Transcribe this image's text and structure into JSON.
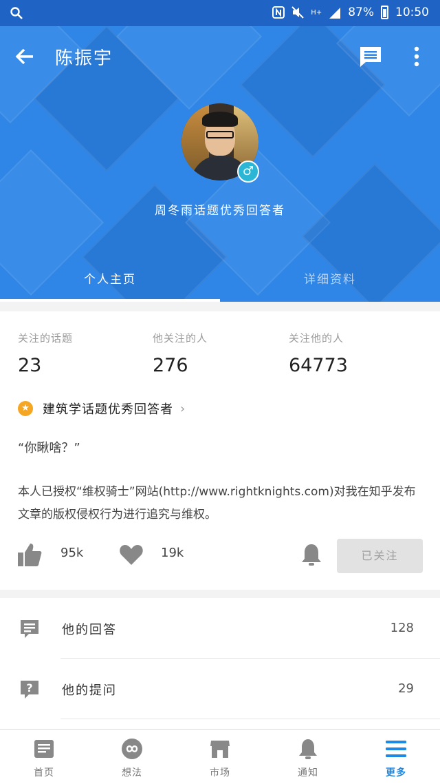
{
  "status_bar": {
    "battery": "87%",
    "time": "10:50",
    "network": "H+",
    "icons": [
      "search-icon",
      "nfc-icon",
      "mute-icon",
      "signal-icon",
      "battery-icon"
    ]
  },
  "header": {
    "title": "陈振宇",
    "headline": "周冬雨话题优秀回答者",
    "gender_symbol": "♂",
    "tabs": [
      {
        "label": "个人主页",
        "active": true
      },
      {
        "label": "详细资料",
        "active": false
      }
    ],
    "accent_color": "#2f86e6"
  },
  "stats": [
    {
      "label": "关注的话题",
      "value": "23"
    },
    {
      "label": "他关注的人",
      "value": "276"
    },
    {
      "label": "关注他的人",
      "value": "64773"
    }
  ],
  "badge": {
    "label": "建筑学话题优秀回答者",
    "chevron": "›",
    "icon_symbol": "★",
    "color": "#f5a623"
  },
  "bio": {
    "quote": "“你瞅啥？”",
    "description": "本人已授权“维权骑士”网站(http://www.rightknights.com)对我在知乎发布文章的版权侵权行为进行追究与维权。"
  },
  "actions": {
    "likes": "95k",
    "thanks": "19k",
    "follow_label": "已关注"
  },
  "list": [
    {
      "label": "他的回答",
      "count": "128",
      "icon": "answer-icon"
    },
    {
      "label": "他的提问",
      "count": "29",
      "icon": "question-icon"
    }
  ],
  "bottom_nav": [
    {
      "label": "首页",
      "icon": "home-icon",
      "active": false
    },
    {
      "label": "想法",
      "icon": "ideas-icon",
      "active": false
    },
    {
      "label": "市场",
      "icon": "market-icon",
      "active": false
    },
    {
      "label": "通知",
      "icon": "bell-icon",
      "active": false
    },
    {
      "label": "更多",
      "icon": "menu-icon",
      "active": true
    }
  ]
}
